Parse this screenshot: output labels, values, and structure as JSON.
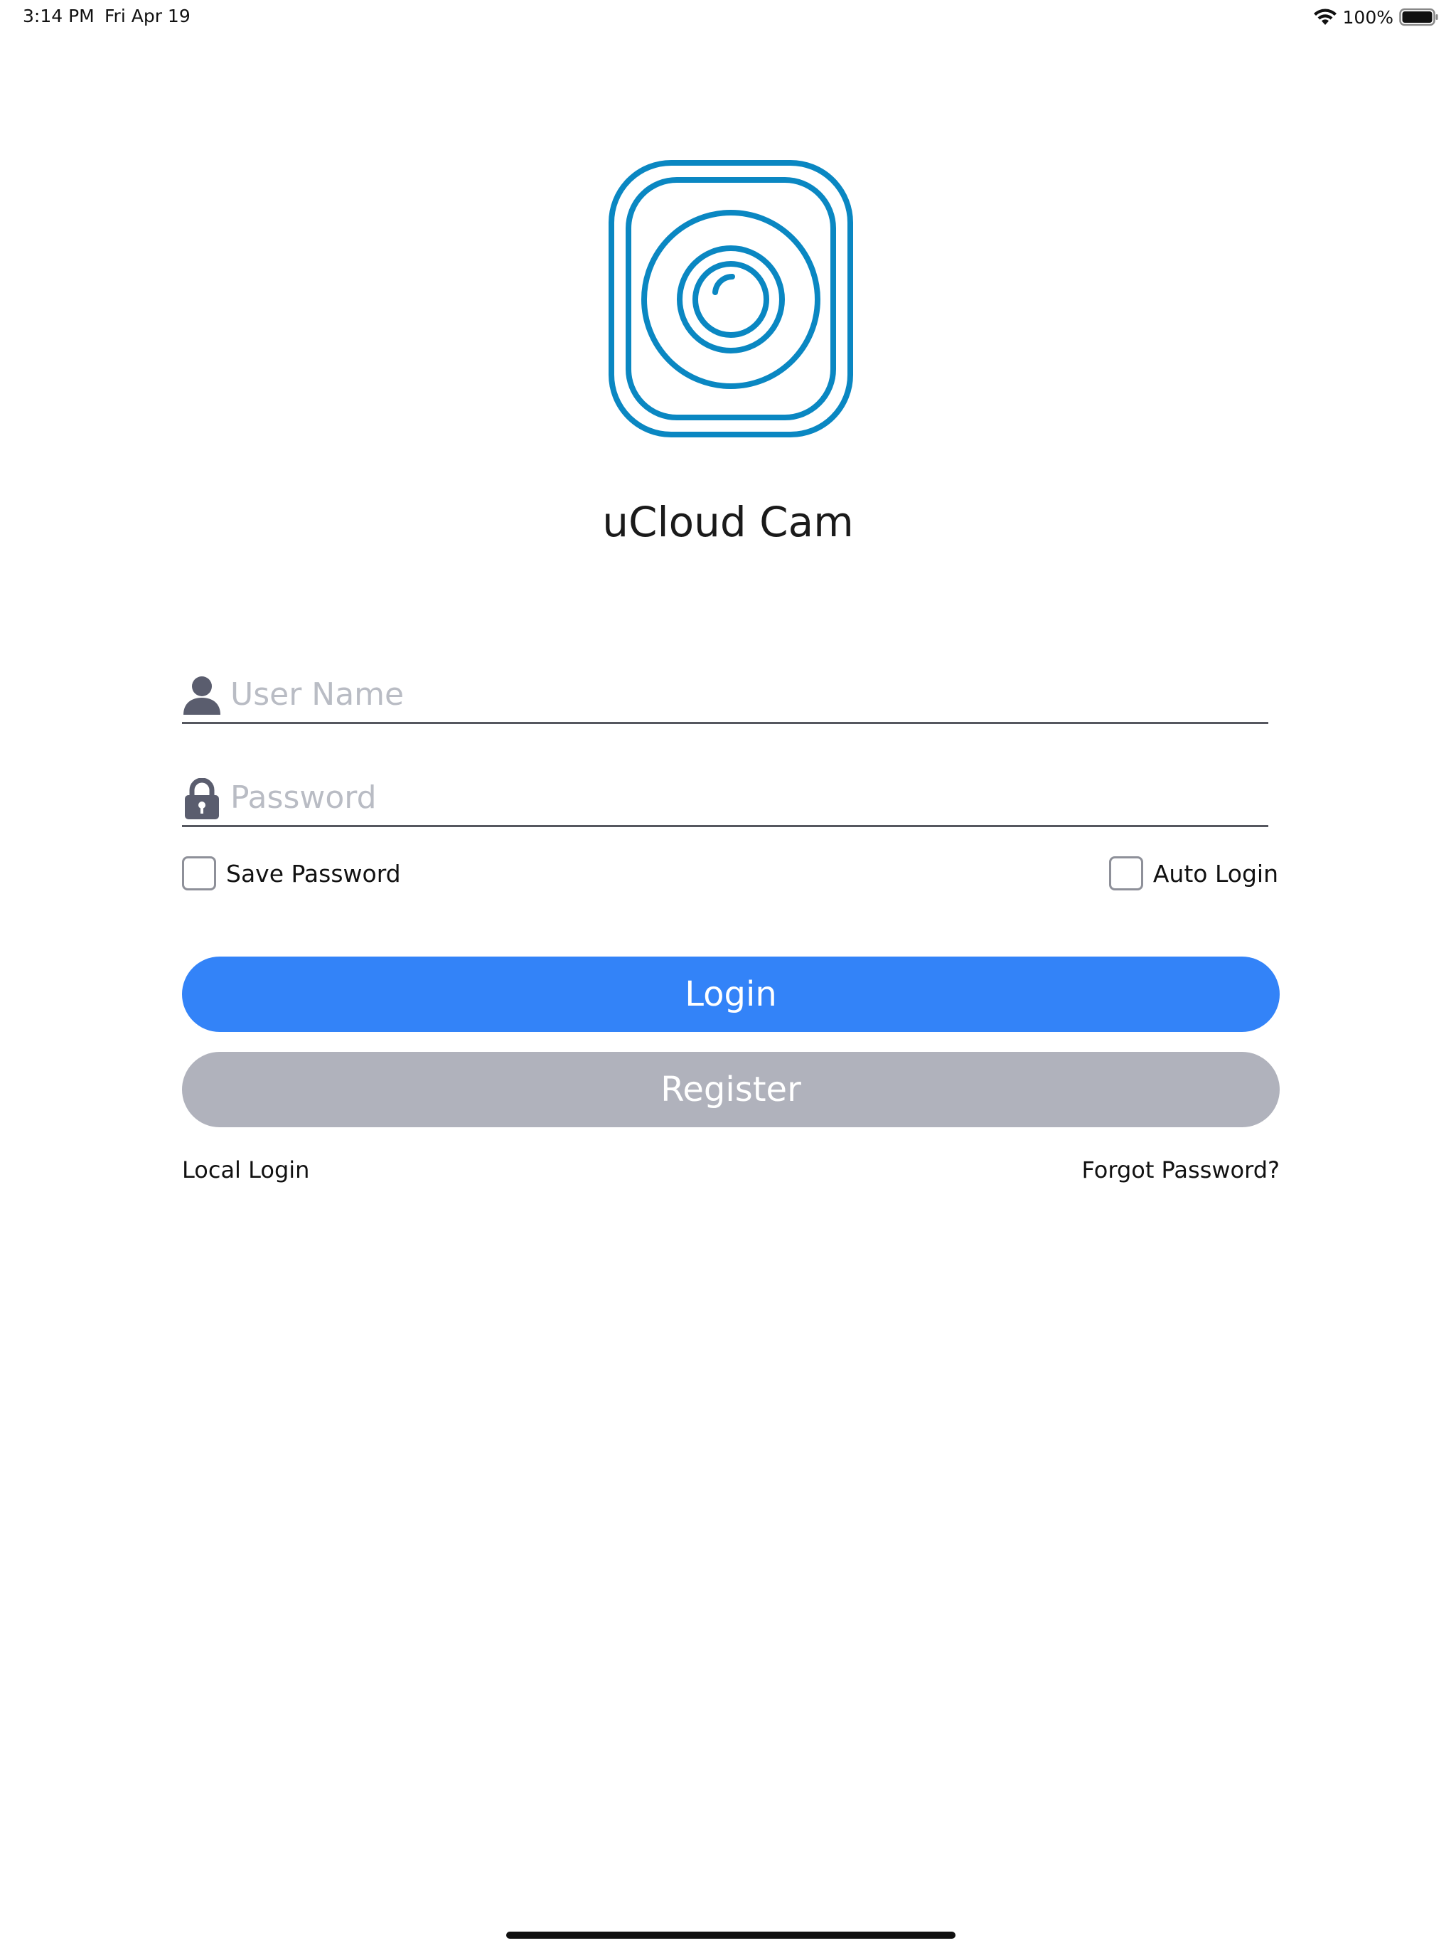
{
  "status_bar": {
    "time": "3:14 PM",
    "date": "Fri Apr 19",
    "battery": "100%"
  },
  "app": {
    "title": "uCloud Cam",
    "brand_color": "#0a87c2"
  },
  "form": {
    "username": {
      "placeholder": "User Name",
      "value": "",
      "icon": "user-icon"
    },
    "password": {
      "placeholder": "Password",
      "value": "",
      "icon": "lock-icon"
    },
    "save_password": {
      "label": "Save Password",
      "checked": false
    },
    "auto_login": {
      "label": "Auto Login",
      "checked": false
    }
  },
  "buttons": {
    "login": "Login",
    "register": "Register",
    "login_color": "#3383f8",
    "register_color": "#b0b2bc"
  },
  "links": {
    "local_login": "Local Login",
    "forgot_password": "Forgot Password?"
  }
}
